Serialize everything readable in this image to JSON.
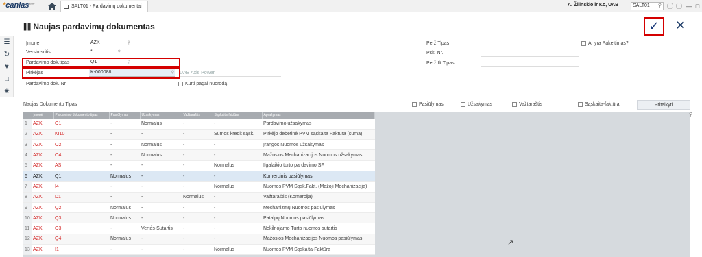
{
  "topbar": {
    "logo": "canias",
    "logo_sup": "ERP",
    "tab_label": "SALT01 - Pardavimų dokumentai",
    "company": "A. Žilinskio ir Ko, UAB",
    "search_value": "SALT01",
    "icons": [
      "home-icon",
      "help-icon",
      "info-icon",
      "minimize-icon",
      "restore-icon",
      "close-icon"
    ]
  },
  "sidebar": {
    "icons": [
      "list-icon",
      "history-icon",
      "favorite-icon",
      "chat-icon",
      "network-icon"
    ]
  },
  "header": {
    "title": "Naujas pardavimų dokumentas",
    "ok_symbol": "✓",
    "close_symbol": "✕"
  },
  "form": {
    "imone_label": "Įmonė",
    "imone_value": "AZK",
    "verslo_label": "Verslo sritis",
    "verslo_value": "*",
    "doktipas_label": "Pardavimo dok.tipas",
    "doktipas_value": "Q1",
    "pirkejas_label": "Pirkėjas",
    "pirkejas_value": "K-000088",
    "pirkejas_name": "UAB Axis Power",
    "doknr_label": "Pardavimo dok. Nr",
    "doknr_value": "",
    "kurti_label": "Kurti pagal nuorodą",
    "pert_tipas_label": "Perž.Tipas",
    "psk_nr_label": "Psk. Nr.",
    "pert_ilt_label": "Perž.Ilt.Tipas",
    "ar_yra_label": "Ar yra Pakeitimas?"
  },
  "section": {
    "title": "Naujas Dokumento Tipas",
    "filters": [
      "Pasiūlymas",
      "Užsakymas",
      "Važtaraštis",
      "Sąskaita-faktūra"
    ],
    "apply_label": "Pritaikyti"
  },
  "table": {
    "headers": [
      "",
      "Įmonė",
      "Pardavimo dokumento tipas",
      "Pasiūlymas",
      "Užsakymas",
      "Važtaraštis",
      "Sąskaita-faktūra",
      "Aprašymas"
    ],
    "selected_row": 5,
    "rows": [
      [
        "1",
        "AZK",
        "O1",
        "-",
        "Normalus",
        "-",
        "-",
        "Pardavimo užsakymas"
      ],
      [
        "2",
        "AZK",
        "KI10",
        "-",
        "-",
        "-",
        "Sumos kredit sąsk.",
        "Pirkėjo debetinė PVM sąskaita Faktūra (suma)"
      ],
      [
        "3",
        "AZK",
        "O2",
        "-",
        "Normalus",
        "-",
        "-",
        "Įrangos Nuomos užsakymas"
      ],
      [
        "4",
        "AZK",
        "O4",
        "-",
        "Normalus",
        "-",
        "-",
        "Mažosios Mechanizacijos Nuomos užsakymas"
      ],
      [
        "5",
        "AZK",
        "AS",
        "-",
        "-",
        "-",
        "Normalus",
        "Ilgalaikio turto pardavimo SF"
      ],
      [
        "6",
        "AZK",
        "Q1",
        "Normalus",
        "-",
        "-",
        "-",
        "Komercinis pasiūlymas"
      ],
      [
        "7",
        "AZK",
        "I4",
        "-",
        "-",
        "-",
        "Normalus",
        "Nuomos PVM Sąsk.Fakt. (Mažoji Mechanizacija)"
      ],
      [
        "8",
        "AZK",
        "D1",
        "-",
        "-",
        "Normalus",
        "-",
        "Važtaraštis (Komercija)"
      ],
      [
        "9",
        "AZK",
        "Q2",
        "Normalus",
        "-",
        "-",
        "-",
        "Mechanizmų Nuomos pasiūlymas"
      ],
      [
        "10",
        "AZK",
        "Q3",
        "Normalus",
        "-",
        "-",
        "-",
        "Patalpų Nuomos pasiūlymas"
      ],
      [
        "11",
        "AZK",
        "O3",
        "-",
        "Vertės-Sutartis",
        "-",
        "-",
        "Nekilnojamo Turto nuomos sutartis"
      ],
      [
        "12",
        "AZK",
        "Q4",
        "Normalus",
        "-",
        "-",
        "-",
        "Mažosios Mechanizacijos Nuomos pasiūlymas"
      ],
      [
        "13",
        "AZK",
        "I1",
        "-",
        "-",
        "-",
        "Normalus",
        "Nuomos PVM Sąskaita-Faktūra"
      ]
    ]
  }
}
